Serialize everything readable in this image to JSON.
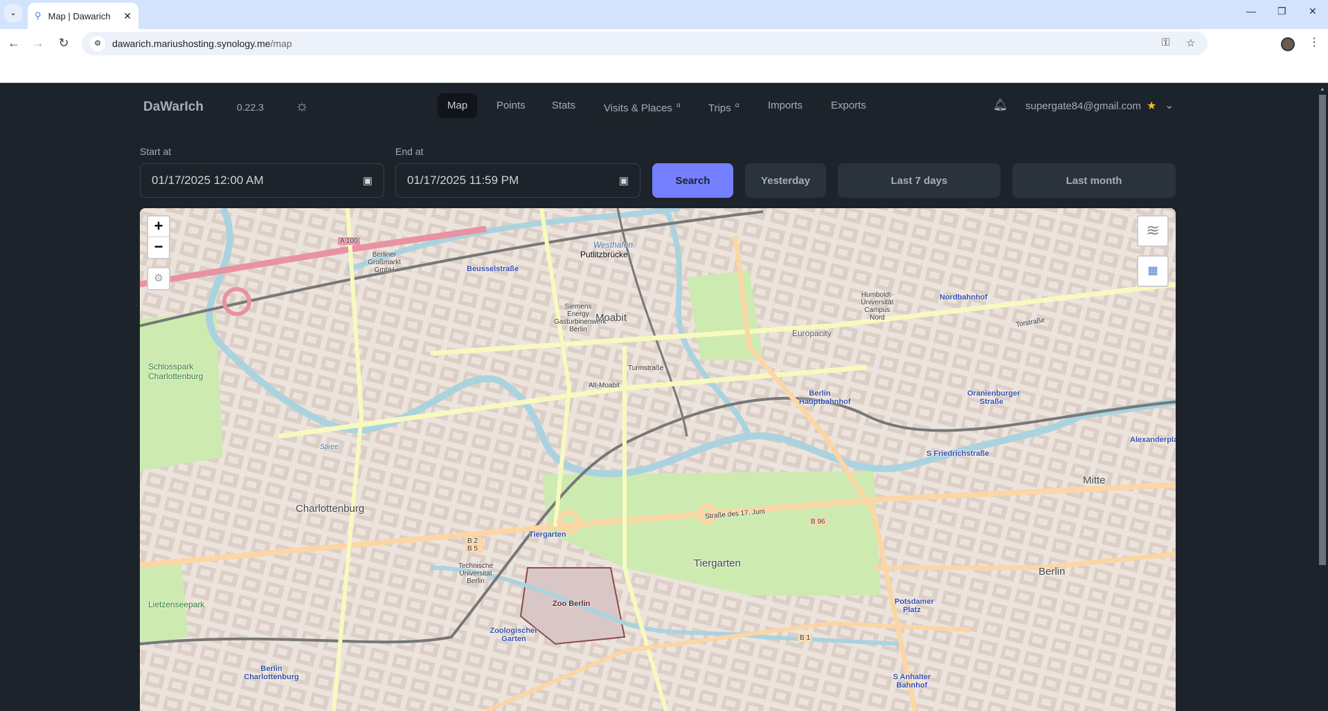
{
  "browser": {
    "tab_title": "Map | Dawarich",
    "url_host": "dawarich.mariushosting.synology.me",
    "url_path": "/map"
  },
  "navbar": {
    "brand": "DaWarIch",
    "version": "0.22.3",
    "theme_icon": "sun-icon",
    "items": [
      {
        "label": "Map",
        "active": true
      },
      {
        "label": "Points"
      },
      {
        "label": "Stats"
      },
      {
        "label": "Visits & Places",
        "badge": "α"
      },
      {
        "label": "Trips",
        "badge": "α"
      },
      {
        "label": "Imports"
      },
      {
        "label": "Exports"
      }
    ],
    "user_email": "supergate84@gmail.com"
  },
  "filters": {
    "start_label": "Start at",
    "start_value": "01/17/2025 12:00 AM",
    "end_label": "End at",
    "end_value": "01/17/2025 11:59 PM",
    "search": "Search",
    "yesterday": "Yesterday",
    "last7": "Last 7 days",
    "last_month": "Last month"
  },
  "map": {
    "zoom_in": "+",
    "zoom_out": "−",
    "labels": {
      "moabit": "Moabit",
      "charlottenburg": "Charlottenburg",
      "tiergarten": "Tiergarten",
      "berlin": "Berlin",
      "mitte": "Mitte",
      "hbf": "Berlin Hauptbahnhof",
      "zoo": "Zoo Berlin",
      "schlosspark": "Schlosspark Charlottenburg",
      "europacity": "Europacity",
      "nordbahnhof": "Nordbahnhof",
      "oranienburger": "Oranienburger Straße",
      "friedrichstr": "S Friedrichstraße",
      "potsdamer": "Potsdamer Platz",
      "zoogarten": "Zoologischer Garten",
      "tiergarten_st": "Tiergarten",
      "westhafen": "Westhafen",
      "putlitz": "Putlitzbrücke",
      "beussel": "Beusselstraße",
      "juni": "Straße des 17. Juni",
      "alex": "Alexanderplat",
      "anhalter": "S Anhalter Bahnhof",
      "charl_st": "Berlin Charlottenburg",
      "tu": "Technische Universität Berlin",
      "lietzensee": "Lietzenseepark",
      "turmstr": "Turmstraße",
      "altmoabit": "Alt-Moabit",
      "a100": "A 100",
      "b96": "B 96",
      "b1": "B 1",
      "b2b5": "B 2 B 5",
      "humboldt": "Humboldt-Universität Campus Nord",
      "torstr": "Torstraße",
      "spree": "Spree",
      "siemens": "Siemens Energy Gasturbinenwerk Berlin",
      "grossmarkt": "Berliner Großmarkt GmbH"
    }
  }
}
